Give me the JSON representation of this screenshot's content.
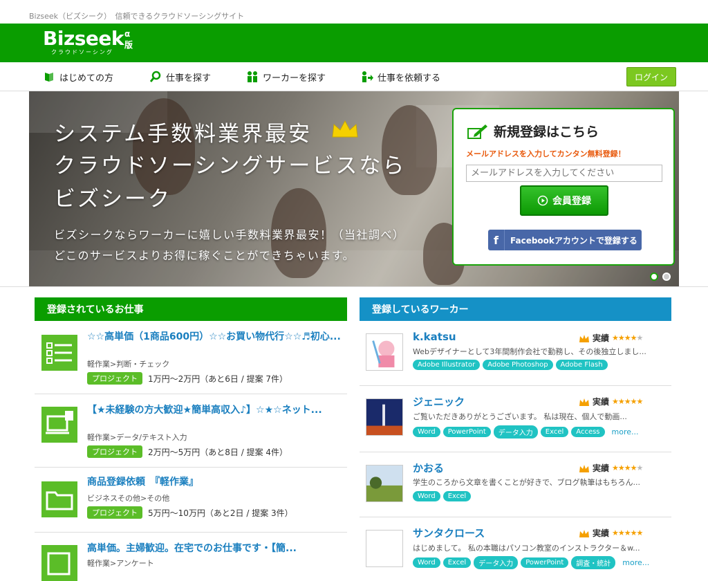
{
  "topline": "Bizseek（ビズシーク）　信頼できるクラウドソーシングサイト",
  "logo": {
    "word": "Bizseek",
    "alpha": "α版",
    "sub": "クラウドソーシング"
  },
  "nav": {
    "items": [
      {
        "label": "はじめての方"
      },
      {
        "label": "仕事を探す"
      },
      {
        "label": "ワーカーを探す"
      },
      {
        "label": "仕事を依頼する"
      }
    ],
    "login": "ログイン"
  },
  "hero": {
    "line1": "システム手数料業界最安",
    "line2": "クラウドソーシングサービスなら",
    "line3": "ビズシーク",
    "p1": "ビズシークならワーカーに嬉しい手数料業界最安！（当社調べ）",
    "p2": "どこのサービスよりお得に稼ぐことができちゃいます。"
  },
  "register": {
    "title": "新規登録はこちら",
    "subtitle": "メールアドレスを入力してカンタン無料登録！",
    "placeholder": "メールアドレスを入力してください",
    "button": "会員登録",
    "facebook": "Facebookアカウントで登録する"
  },
  "jobs": {
    "heading": "登録されているお仕事",
    "items": [
      {
        "title": "☆☆高単価（1商品600円）☆☆お買い物代行☆☆♬初心...",
        "category": "軽作業>判断・チェック",
        "tag": "プロジェクト",
        "meta": "1万円〜2万円（あと6日 / 提案 7件）"
      },
      {
        "title": "【★未経験の方大歓迎★簡単高収入♪】☆★☆ネット...",
        "category": "軽作業>データ/テキスト入力",
        "tag": "プロジェクト",
        "meta": "2万円〜5万円（あと8日 / 提案 4件）"
      },
      {
        "title": "商品登録依頼　『軽作業』",
        "category": "ビジネスその他>その他",
        "tag": "プロジェクト",
        "meta": "5万円〜10万円（あと2日 / 提案 3件）"
      },
      {
        "title": "高単価。主婦歓迎。在宅でのお仕事です・【簡...",
        "category": "軽作業>アンケート",
        "tag": "",
        "meta": ""
      }
    ]
  },
  "workers": {
    "heading": "登録しているワーカー",
    "rating_label": "実績",
    "more": "more...",
    "items": [
      {
        "name": "k.katsu",
        "stars": 4,
        "desc": "Webデザイナーとして3年間制作会社で勤務し、その後独立しまし...",
        "skills": [
          "Adobe Illustrator",
          "Adobe Photoshop",
          "Adobe Flash"
        ],
        "more": false
      },
      {
        "name": "ジェニック",
        "stars": 5,
        "desc": "ご覧いただきありがとうございます。 私は現在、個人で動画...",
        "skills": [
          "Word",
          "PowerPoint",
          "データ入力",
          "Excel",
          "Access"
        ],
        "more": true
      },
      {
        "name": "かおる",
        "stars": 4,
        "desc": "学生のころから文章を書くことが好きで、ブログ執筆はもちろん...",
        "skills": [
          "Word",
          "Excel"
        ],
        "more": false
      },
      {
        "name": "サンタクロース",
        "stars": 5,
        "desc": "はじめまして。 私の本職はパソコン教室のインストラクター＆w...",
        "skills": [
          "Word",
          "Excel",
          "データ入力",
          "PowerPoint",
          "調査・統計"
        ],
        "more": true
      }
    ]
  },
  "colors": {
    "green": "#0a9d00",
    "blue": "#1591c6",
    "teal": "#20c3c3",
    "orange": "#e8590c"
  }
}
